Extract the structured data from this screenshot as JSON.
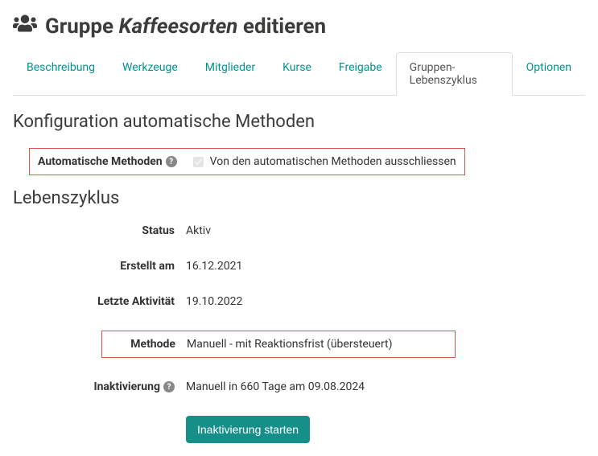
{
  "header": {
    "title_prefix": "Gruppe",
    "title_italic": "Kaffeesorten",
    "title_suffix": "editieren"
  },
  "tabs": [
    {
      "label": "Beschreibung"
    },
    {
      "label": "Werkzeuge"
    },
    {
      "label": "Mitglieder"
    },
    {
      "label": "Kurse"
    },
    {
      "label": "Freigabe"
    },
    {
      "label": "Gruppen-Lebenszyklus"
    },
    {
      "label": "Optionen"
    }
  ],
  "sections": {
    "auto_methods": {
      "heading": "Konfiguration automatische Methoden",
      "label": "Automatische Methoden",
      "checkbox_label": "Von den automatischen Methoden ausschliessen"
    },
    "lifecycle": {
      "heading": "Lebenszyklus",
      "rows": {
        "status": {
          "label": "Status",
          "value": "Aktiv"
        },
        "created": {
          "label": "Erstellt am",
          "value": "16.12.2021"
        },
        "last_activity": {
          "label": "Letzte Aktivität",
          "value": "19.10.2022"
        },
        "method": {
          "label": "Methode",
          "value": "Manuell - mit Reaktionsfrist (übersteuert)"
        },
        "inactivation": {
          "label": "Inaktivierung",
          "value": "Manuell in 660 Tage am 09.08.2024"
        }
      },
      "button": "Inaktivierung starten"
    }
  }
}
